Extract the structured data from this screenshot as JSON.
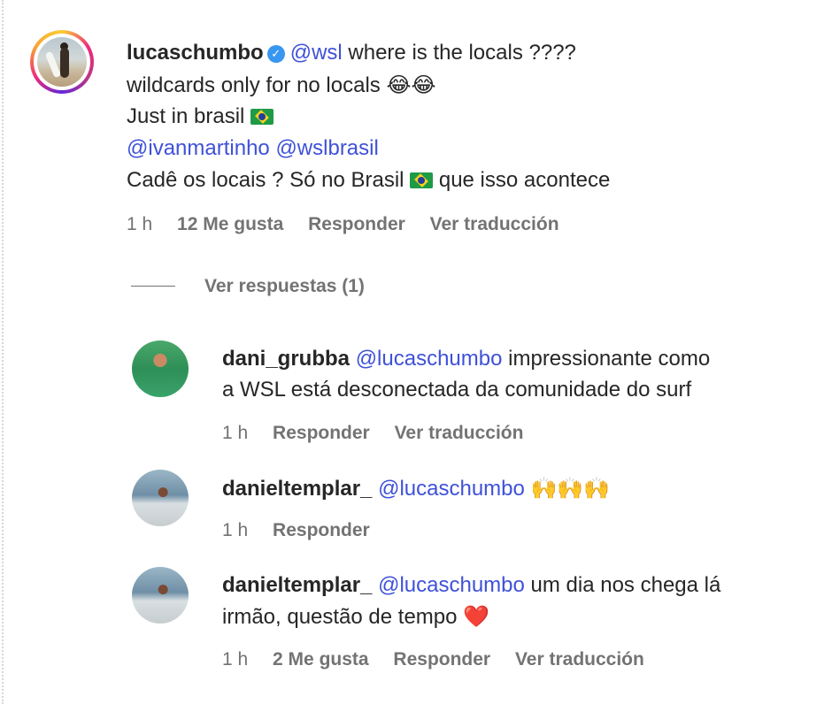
{
  "main_comment": {
    "username": "lucaschumbo",
    "verified_icon": "verified-badge-icon",
    "mention": "@wsl",
    "line1_text": "where is the locals ????",
    "line2_text": "wildcards only for no locals",
    "line2_emoji": "😂😂",
    "line3_text": "Just in brasil",
    "line3_flag": "brazil-flag-icon",
    "line4_mention1": "@ivanmartinho",
    "line4_mention2": "@wslbrasil",
    "line5_text_a": "Cadê os locais ? Só no Brasil",
    "line5_flag": "brazil-flag-icon",
    "line5_text_b": "que isso acontece",
    "time": "1 h",
    "likes": "12 Me gusta",
    "reply": "Responder",
    "translate": "Ver traducción"
  },
  "view_replies": "Ver respuestas (1)",
  "replies": [
    {
      "username": "dani_grubba",
      "mention": "@lucaschumbo",
      "line1_text": "impressionante como",
      "line2_text": "a WSL está desconectada da comunidade do surf",
      "time": "1 h",
      "reply": "Responder",
      "translate": "Ver traducción"
    },
    {
      "username": "danieltemplar_",
      "mention": "@lucaschumbo",
      "emoji": "🙌🙌🙌",
      "time": "1 h",
      "reply": "Responder"
    },
    {
      "username": "danieltemplar_",
      "mention": "@lucaschumbo",
      "line1_text": "um dia nos chega lá",
      "line2_text": "irmão, questão de tempo",
      "emoji": "❤️",
      "time": "1 h",
      "likes": "2 Me gusta",
      "reply": "Responder",
      "translate": "Ver traducción"
    }
  ],
  "colors": {
    "mention": "#3f51d8",
    "meta": "#737373",
    "text": "#262626",
    "verified": "#3897f0"
  }
}
